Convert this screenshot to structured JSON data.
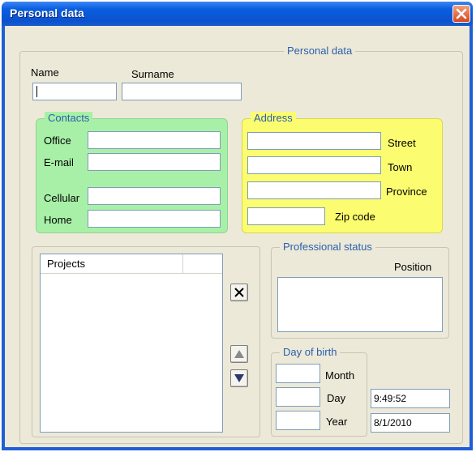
{
  "window": {
    "title": "Personal data"
  },
  "personal": {
    "group_label": "Personal data",
    "name_label": "Name",
    "name_value": "",
    "surname_label": "Surname",
    "surname_value": ""
  },
  "contacts": {
    "group_label": "Contacts",
    "office_label": "Office",
    "email_label": "E-mail",
    "cellular_label": "Cellular",
    "home_label": "Home",
    "office_value": "",
    "email_value": "",
    "cellular_value": "",
    "home_value": "",
    "bg_color": "#a8f0a8"
  },
  "address": {
    "group_label": "Address",
    "street_label": "Street",
    "town_label": "Town",
    "province_label": "Province",
    "zip_label": "Zip code",
    "street_value": "",
    "town_value": "",
    "province_value": "",
    "zip_value": "",
    "bg_color": "#fcfc70"
  },
  "projects": {
    "column_header": "Projects"
  },
  "professional": {
    "group_label": "Professional status",
    "position_label": "Position",
    "position_value": ""
  },
  "birth": {
    "group_label": "Day of birth",
    "month_label": "Month",
    "day_label": "Day",
    "year_label": "Year",
    "month_value": "",
    "day_value": "",
    "year_value": ""
  },
  "time_value": "9:49:52",
  "date_value": "8/1/2010",
  "icons": {
    "close": "close-icon",
    "delete": "x-icon",
    "up": "arrow-up-icon",
    "down": "arrow-down-icon"
  }
}
